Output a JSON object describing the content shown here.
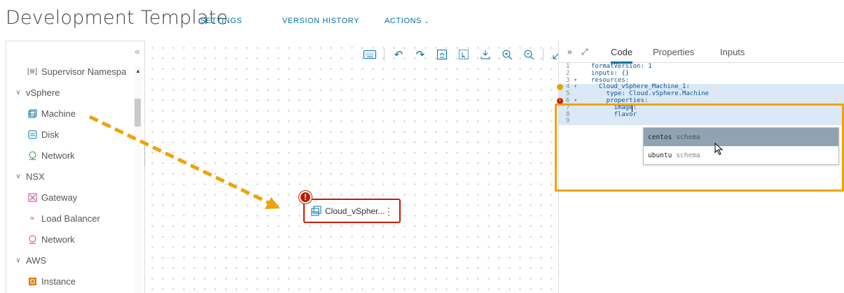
{
  "header": {
    "title": "Development Template",
    "links": {
      "settings": "SETTINGS",
      "version_history": "VERSION HISTORY",
      "actions": "ACTIONS"
    }
  },
  "palette": {
    "collapse_icon": "double-chevron-left-icon",
    "items": [
      {
        "label": "Supervisor Namespa",
        "icon": "namespace-icon"
      },
      {
        "label": "vSphere",
        "type": "category"
      },
      {
        "label": "Machine",
        "icon": "machine-icon"
      },
      {
        "label": "Disk",
        "icon": "disk-icon"
      },
      {
        "label": "Network",
        "icon": "network-icon"
      },
      {
        "label": "NSX",
        "type": "category"
      },
      {
        "label": "Gateway",
        "icon": "gateway-icon"
      },
      {
        "label": "Load Balancer",
        "icon": "load-balancer-icon"
      },
      {
        "label": "Network",
        "icon": "network-icon"
      },
      {
        "label": "AWS",
        "type": "category"
      },
      {
        "label": "Instance",
        "icon": "instance-icon"
      }
    ]
  },
  "canvas": {
    "node": {
      "label": "Cloud_vSpher..."
    },
    "toolbar": [
      "keyboard-icon",
      "undo-icon",
      "redo-icon",
      "fit-icon",
      "select-icon",
      "download-icon",
      "zoom-in-icon",
      "zoom-out-icon",
      "expand-icon"
    ]
  },
  "right_panel": {
    "tabs": [
      "Code",
      "Properties",
      "Inputs"
    ],
    "code_lines": [
      {
        "n": "1",
        "text": "formatVersion: 1"
      },
      {
        "n": "2",
        "text": "inputs: {}"
      },
      {
        "n": "3 ▾",
        "text": "resources:"
      },
      {
        "n": "4 ▾",
        "text": "  Cloud_vSphere_Machine_1:"
      },
      {
        "n": "5",
        "text": "    type: Cloud.vSphere.Machine"
      },
      {
        "n": "6 ▾",
        "text": "    properties:"
      },
      {
        "n": "7",
        "text": "      image: "
      },
      {
        "n": "8",
        "text": "      flavor"
      },
      {
        "n": "9",
        "text": ""
      }
    ],
    "autocomplete": [
      {
        "value": "centos",
        "type": "schema"
      },
      {
        "value": "ubuntu",
        "type": "schema"
      }
    ]
  },
  "colors": {
    "accent": "#0072a3",
    "error": "#c21d00",
    "warning": "#e8a400",
    "highlight": "#f0a20b"
  }
}
